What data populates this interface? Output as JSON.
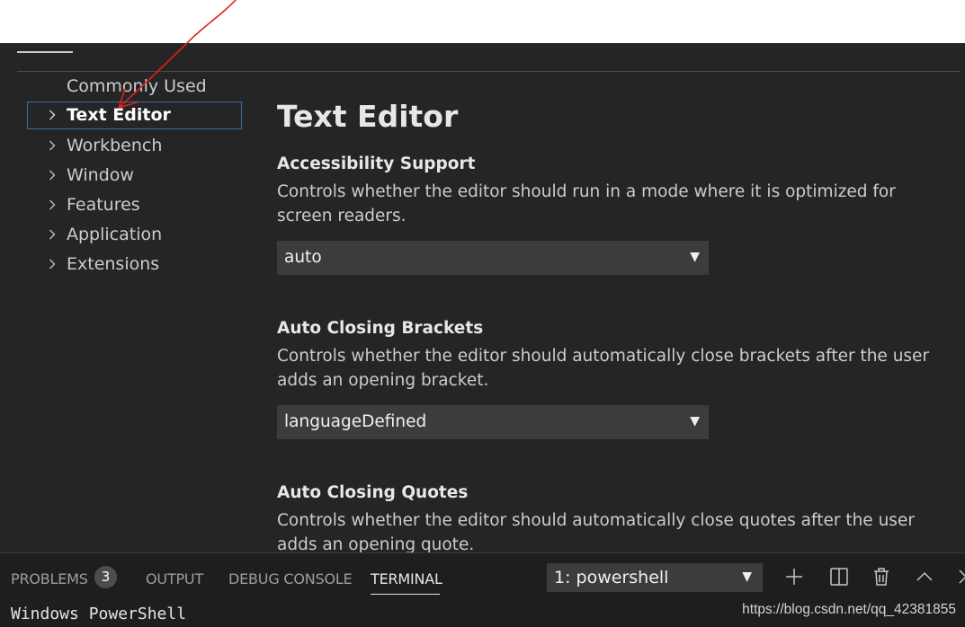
{
  "toc": {
    "items": [
      {
        "label": "Commonly Used",
        "has_chevron": false
      },
      {
        "label": "Text Editor",
        "has_chevron": true,
        "selected": true
      },
      {
        "label": "Workbench",
        "has_chevron": true
      },
      {
        "label": "Window",
        "has_chevron": true
      },
      {
        "label": "Features",
        "has_chevron": true
      },
      {
        "label": "Application",
        "has_chevron": true
      },
      {
        "label": "Extensions",
        "has_chevron": true
      }
    ]
  },
  "content": {
    "title": "Text Editor",
    "settings": [
      {
        "title": "Accessibility Support",
        "description": "Controls whether the editor should run in a mode where it is optimized for screen readers.",
        "value": "auto"
      },
      {
        "title": "Auto Closing Brackets",
        "description": "Controls whether the editor should automatically close brackets after the user adds an opening bracket.",
        "value": "languageDefined"
      },
      {
        "title": "Auto Closing Quotes",
        "description": "Controls whether the editor should automatically close quotes after the user adds an opening quote."
      }
    ]
  },
  "panel": {
    "tabs": {
      "problems": "PROBLEMS",
      "output": "OUTPUT",
      "debug_console": "DEBUG CONSOLE",
      "terminal": "TERMINAL"
    },
    "problems_count": "3",
    "terminal_select_value": "1: powershell",
    "terminal_line_1": "Windows PowerShell"
  },
  "watermark": "https://blog.csdn.net/qq_42381855",
  "colors": {
    "panel_bg": "#252526",
    "select_bg": "#3c3c3c",
    "focus_border": "#3e6aa0",
    "annotation_red": "#e02020"
  },
  "icons": {
    "toc_chevron": "chevron-right-icon",
    "terminal_actions": [
      "plus-icon",
      "split-icon",
      "trash-icon",
      "chevron-up-icon",
      "close-icon"
    ]
  }
}
